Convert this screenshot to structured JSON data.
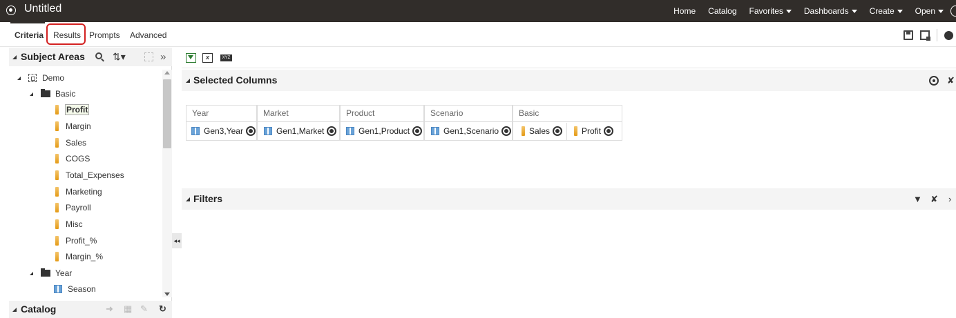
{
  "app": {
    "title": "Untitled",
    "nav": [
      {
        "label": "Home",
        "dropdown": false
      },
      {
        "label": "Catalog",
        "dropdown": false
      },
      {
        "label": "Favorites",
        "dropdown": true
      },
      {
        "label": "Dashboards",
        "dropdown": true
      },
      {
        "label": "Create",
        "dropdown": true
      },
      {
        "label": "Open",
        "dropdown": true
      }
    ]
  },
  "tabs": [
    {
      "label": "Criteria",
      "active": true
    },
    {
      "label": "Results",
      "active": false,
      "highlighted": true
    },
    {
      "label": "Prompts",
      "active": false
    },
    {
      "label": "Advanced",
      "active": false
    }
  ],
  "subject_areas": {
    "title": "Subject Areas",
    "tree": [
      {
        "label": "Demo",
        "type": "cube"
      },
      {
        "label": "Basic",
        "type": "folder"
      },
      {
        "label": "Profit",
        "type": "measure",
        "selected": true
      },
      {
        "label": "Margin",
        "type": "measure"
      },
      {
        "label": "Sales",
        "type": "measure"
      },
      {
        "label": "COGS",
        "type": "measure"
      },
      {
        "label": "Total_Expenses",
        "type": "measure"
      },
      {
        "label": "Marketing",
        "type": "measure"
      },
      {
        "label": "Payroll",
        "type": "measure"
      },
      {
        "label": "Misc",
        "type": "measure"
      },
      {
        "label": "Profit_%",
        "type": "measure"
      },
      {
        "label": "Margin_%",
        "type": "measure"
      },
      {
        "label": "Year",
        "type": "folder"
      },
      {
        "label": "Season",
        "type": "attribute"
      }
    ]
  },
  "catalog": {
    "title": "Catalog"
  },
  "selected_columns": {
    "title": "Selected Columns",
    "groups": [
      {
        "header": "Year",
        "columns": [
          {
            "label": "Gen3,Year",
            "type": "attribute"
          }
        ]
      },
      {
        "header": "Market",
        "columns": [
          {
            "label": "Gen1,Market",
            "type": "attribute"
          }
        ]
      },
      {
        "header": "Product",
        "columns": [
          {
            "label": "Gen1,Product",
            "type": "attribute"
          }
        ]
      },
      {
        "header": "Scenario",
        "columns": [
          {
            "label": "Gen1,Scenario",
            "type": "attribute"
          }
        ]
      },
      {
        "header": "Basic",
        "columns": [
          {
            "label": "Sales",
            "type": "measure"
          },
          {
            "label": "Profit",
            "type": "measure"
          }
        ]
      }
    ]
  },
  "filters": {
    "title": "Filters"
  },
  "icons": {
    "brand_color": "#312d2a",
    "highlight_color": "#d32020",
    "measure_color": "#e8a42a",
    "attribute_color": "#6aa3d8"
  }
}
